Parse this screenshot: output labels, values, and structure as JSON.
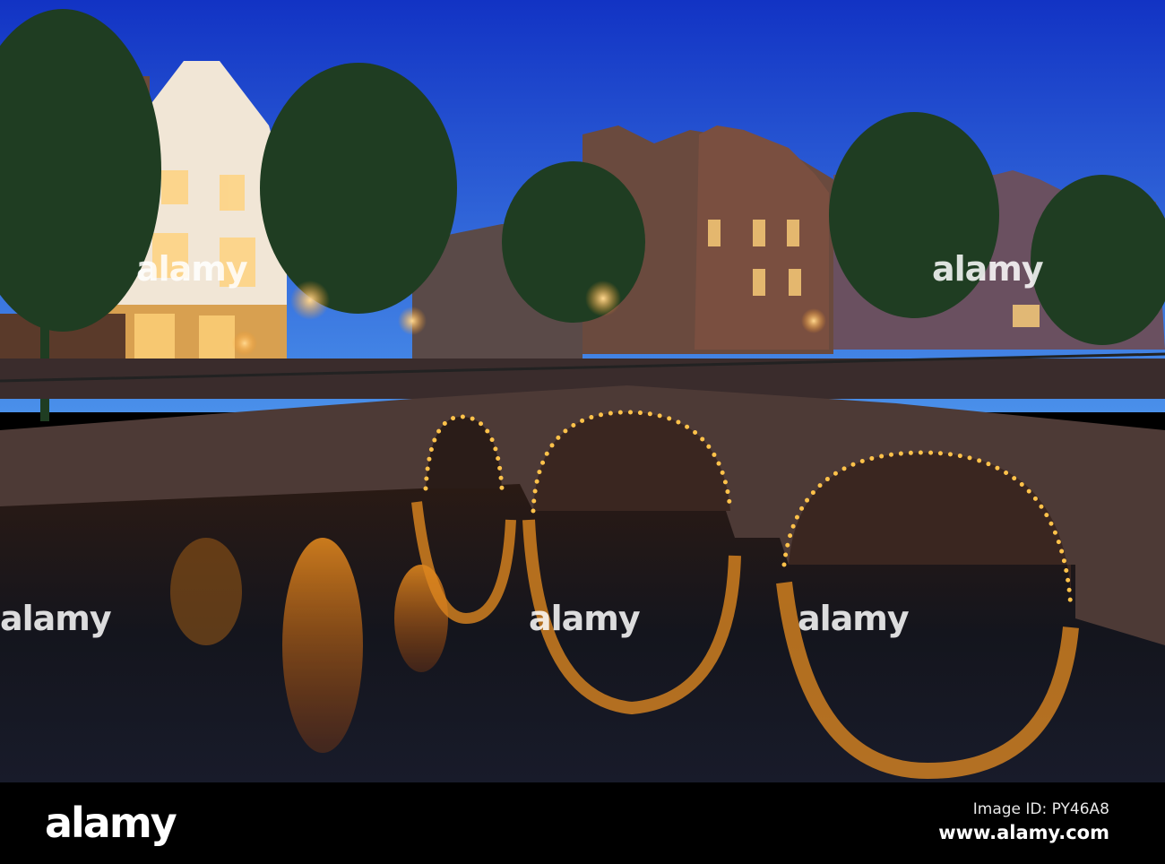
{
  "watermark": {
    "text": "alamy",
    "image_id": "Image ID: PY46A8",
    "site": "www.alamy.com"
  },
  "colors": {
    "sky_top": "#1436c8",
    "sky_bottom": "#3f86e6",
    "lamp": "#ffb13a",
    "water": "#15161c",
    "brick": "#4d3a36"
  }
}
